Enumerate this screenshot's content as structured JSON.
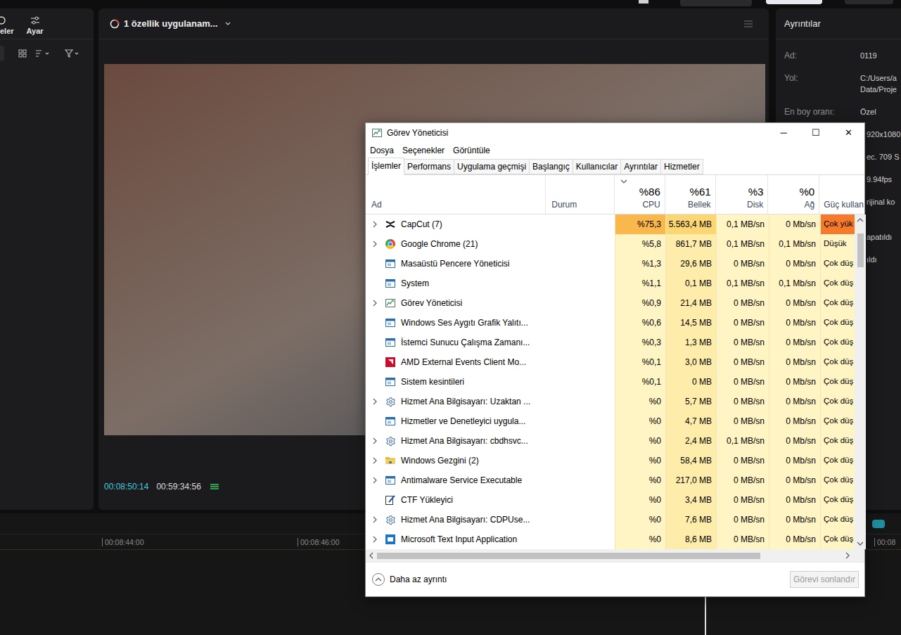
{
  "editor": {
    "left_panel": {
      "tabs": [
        {
          "label": "eler"
        },
        {
          "label": "Ayar"
        }
      ]
    },
    "preview": {
      "title": "1 özellik uygulanam...",
      "current_time": "00:08:50:14",
      "total_time": "00:59:34:56"
    },
    "details": {
      "title": "Ayrıntılar",
      "rows": [
        {
          "label": "Ad:",
          "lines": [
            "0119"
          ]
        },
        {
          "label": "Yol:",
          "lines": [
            "C:/Users/a",
            "Data/Proje"
          ]
        },
        {
          "label": "En boy oranı:",
          "lines": [
            "Özel"
          ]
        }
      ],
      "covered_rows": [
        "920x1080",
        "ec. 709 S",
        "9.94fps",
        "rijinal ko"
      ],
      "covered_rows_2": [
        "apatıldı",
        "ıldı"
      ]
    },
    "timeline": {
      "ticks": [
        "00:08:44:00",
        "00:08:46:00",
        "00:08"
      ]
    }
  },
  "task_manager": {
    "title": "Görev Yöneticisi",
    "controls": [
      "─",
      "☐",
      "✕"
    ],
    "menu": [
      "Dosya",
      "Seçenekler",
      "Görüntüle"
    ],
    "tabs": [
      {
        "label": "İşlemler",
        "selected": true
      },
      {
        "label": "Performans",
        "selected": false
      },
      {
        "label": "Uygulama geçmişi",
        "selected": false
      },
      {
        "label": "Başlangıç",
        "selected": false
      },
      {
        "label": "Kullanıcılar",
        "selected": false
      },
      {
        "label": "Ayrıntılar",
        "selected": false
      },
      {
        "label": "Hizmetler",
        "selected": false
      }
    ],
    "columns": [
      {
        "label": "Ad",
        "total": "",
        "sorted": false
      },
      {
        "label": "Durum",
        "total": "",
        "sorted": false
      },
      {
        "label": "CPU",
        "total": "%86",
        "sorted": true
      },
      {
        "label": "Bellek",
        "total": "%61",
        "sorted": false
      },
      {
        "label": "Disk",
        "total": "%3",
        "sorted": false
      },
      {
        "label": "Ağ",
        "total": "%0",
        "sorted": false
      },
      {
        "label": "Güç kullan",
        "total": "",
        "sorted": false
      }
    ],
    "rows": [
      {
        "name": "CapCut (7)",
        "kind": "capcut",
        "expandable": true,
        "hot": true,
        "cpu": "%75,3",
        "memory": "5.563,4 MB",
        "disk": "0,1 MB/sn",
        "network": "0 Mb/sn",
        "power": "Çok yük"
      },
      {
        "name": "Google Chrome (21)",
        "kind": "chrome",
        "expandable": true,
        "hot": false,
        "cpu": "%5,8",
        "memory": "861,7 MB",
        "disk": "0,1 MB/sn",
        "network": "0,1 Mb/sn",
        "power": "Düşük"
      },
      {
        "name": "Masaüstü Pencere Yöneticisi",
        "kind": "window",
        "expandable": false,
        "hot": false,
        "cpu": "%1,3",
        "memory": "29,6 MB",
        "disk": "0 MB/sn",
        "network": "0 Mb/sn",
        "power": "Çok düş"
      },
      {
        "name": "System",
        "kind": "window",
        "expandable": false,
        "hot": false,
        "cpu": "%1,1",
        "memory": "0,1 MB",
        "disk": "0,1 MB/sn",
        "network": "0,1 Mb/sn",
        "power": "Çok düş"
      },
      {
        "name": "Görev Yöneticisi",
        "kind": "taskmgr",
        "expandable": true,
        "hot": false,
        "cpu": "%0,9",
        "memory": "21,4 MB",
        "disk": "0 MB/sn",
        "network": "0 Mb/sn",
        "power": "Çok düş"
      },
      {
        "name": "Windows Ses Aygıtı Grafik Yalıtı...",
        "kind": "window",
        "expandable": false,
        "hot": false,
        "cpu": "%0,6",
        "memory": "14,5 MB",
        "disk": "0 MB/sn",
        "network": "0 Mb/sn",
        "power": "Çok düş"
      },
      {
        "name": "İstemci Sunucu Çalışma Zamanı...",
        "kind": "window",
        "expandable": false,
        "hot": false,
        "cpu": "%0,3",
        "memory": "1,3 MB",
        "disk": "0 MB/sn",
        "network": "0 Mb/sn",
        "power": "Çok düş"
      },
      {
        "name": "AMD External Events Client Mo...",
        "kind": "amd",
        "expandable": false,
        "hot": false,
        "cpu": "%0,1",
        "memory": "3,0 MB",
        "disk": "0 MB/sn",
        "network": "0 Mb/sn",
        "power": "Çok düş"
      },
      {
        "name": "Sistem kesintileri",
        "kind": "window",
        "expandable": false,
        "hot": false,
        "cpu": "%0,1",
        "memory": "0 MB",
        "disk": "0 MB/sn",
        "network": "0 Mb/sn",
        "power": "Çok düş"
      },
      {
        "name": "Hizmet Ana Bilgisayarı: Uzaktan ...",
        "kind": "service",
        "expandable": true,
        "hot": false,
        "cpu": "%0",
        "memory": "5,7 MB",
        "disk": "0 MB/sn",
        "network": "0 Mb/sn",
        "power": "Çok düş"
      },
      {
        "name": "Hizmetler ve Denetleyici uygula...",
        "kind": "window",
        "expandable": false,
        "hot": false,
        "cpu": "%0",
        "memory": "4,7 MB",
        "disk": "0 MB/sn",
        "network": "0 Mb/sn",
        "power": "Çok düş"
      },
      {
        "name": "Hizmet Ana Bilgisayarı: cbdhsvc...",
        "kind": "service",
        "expandable": true,
        "hot": false,
        "cpu": "%0",
        "memory": "2,4 MB",
        "disk": "0,1 MB/sn",
        "network": "0 Mb/sn",
        "power": "Çok düş"
      },
      {
        "name": "Windows Gezgini (2)",
        "kind": "explorer",
        "expandable": true,
        "hot": false,
        "cpu": "%0",
        "memory": "58,4 MB",
        "disk": "0 MB/sn",
        "network": "0 Mb/sn",
        "power": "Çok düş"
      },
      {
        "name": "Antimalware Service Executable",
        "kind": "window",
        "expandable": true,
        "hot": false,
        "cpu": "%0",
        "memory": "217,0 MB",
        "disk": "0 MB/sn",
        "network": "0 Mb/sn",
        "power": "Çok düş"
      },
      {
        "name": "CTF Yükleyici",
        "kind": "ctf",
        "expandable": false,
        "hot": false,
        "cpu": "%0",
        "memory": "3,4 MB",
        "disk": "0 MB/sn",
        "network": "0 Mb/sn",
        "power": "Çok düş"
      },
      {
        "name": "Hizmet Ana Bilgisayarı: CDPUse...",
        "kind": "service",
        "expandable": true,
        "hot": false,
        "cpu": "%0",
        "memory": "7,6 MB",
        "disk": "0 MB/sn",
        "network": "0 Mb/sn",
        "power": "Çok düş"
      },
      {
        "name": "Microsoft Text Input Application",
        "kind": "input",
        "expandable": true,
        "hot": false,
        "cpu": "%0",
        "memory": "8,6 MB",
        "disk": "0 MB/sn",
        "network": "0 Mb/sn",
        "power": "Çok düş"
      }
    ],
    "footer": {
      "fewer_details": "Daha az ayrıntı",
      "end_task": {
        "label": "Görevi sonlandır",
        "disabled": true
      }
    }
  }
}
